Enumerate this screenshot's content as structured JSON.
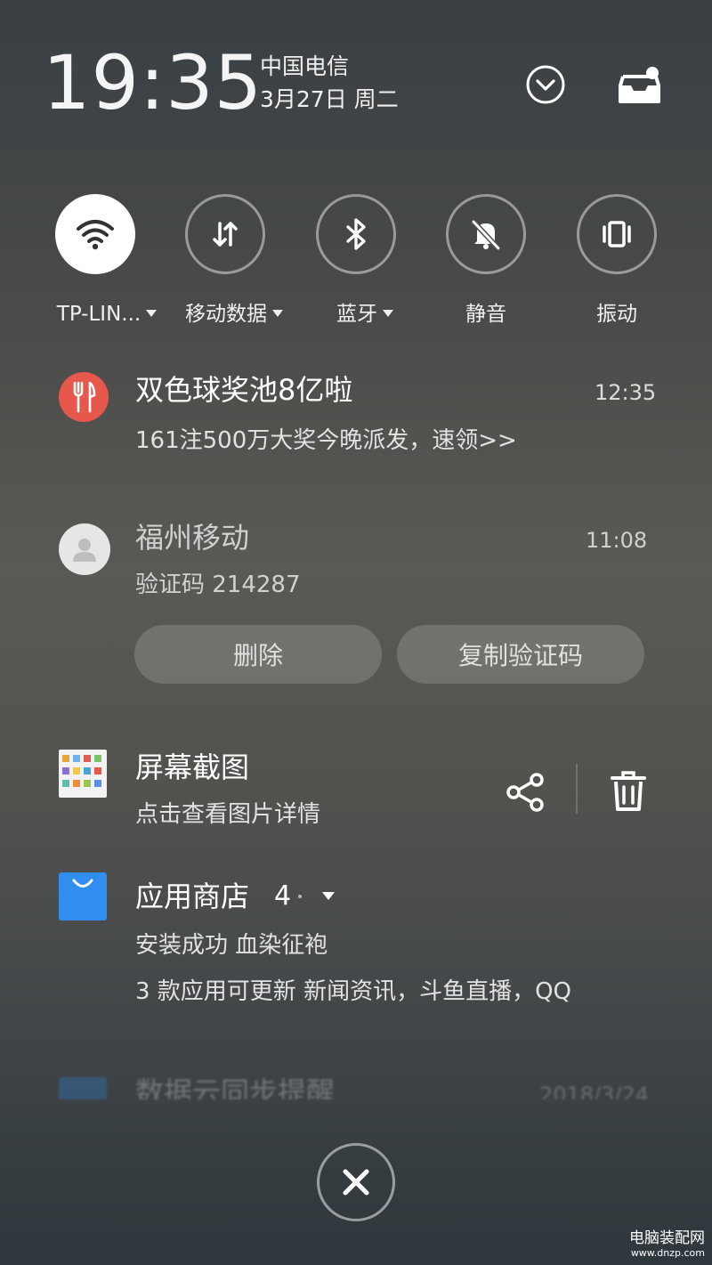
{
  "status": {
    "time": "19:35",
    "carrier": "中国电信",
    "date": "3月27日 周二"
  },
  "header_icons": [
    "chevron-down-icon",
    "inbox-icon"
  ],
  "toggles": [
    {
      "label": "TP-LIN...",
      "icon": "wifi-icon",
      "active": true,
      "has_dropdown": true
    },
    {
      "label": "移动数据",
      "icon": "mobile-data-icon",
      "active": false,
      "has_dropdown": true
    },
    {
      "label": "蓝牙",
      "icon": "bluetooth-icon",
      "active": false,
      "has_dropdown": true
    },
    {
      "label": "静音",
      "icon": "mute-icon",
      "active": false,
      "has_dropdown": false
    },
    {
      "label": "振动",
      "icon": "vibrate-icon",
      "active": false,
      "has_dropdown": false
    }
  ],
  "notifications": {
    "lottery": {
      "title": "双色球奖池8亿啦",
      "time": "12:35",
      "text": "161注500万大奖今晚派发，速领>>",
      "icon": "fork-knife-icon",
      "icon_color": "#e8574b"
    },
    "sms": {
      "title": "福州移动",
      "time": "11:08",
      "text": "验证码 214287",
      "icon": "contact-avatar-icon",
      "actions": {
        "delete": "删除",
        "copy_code": "复制验证码"
      }
    },
    "screenshot": {
      "title": "屏幕截图",
      "text": "点击查看图片详情",
      "icon": "screenshot-thumbnail",
      "actions": [
        "share-icon",
        "trash-icon"
      ]
    },
    "appstore": {
      "title": "应用商店",
      "count": "4",
      "line1": "安装成功 血染征袍",
      "line2": "3 款应用可更新 新闻资讯，斗鱼直播，QQ",
      "icon": "shopping-bag-icon",
      "icon_color": "#2f8ef0"
    },
    "sync": {
      "title": "数据云同步提醒",
      "time": "2018/3/24"
    }
  },
  "close_icon": "close-icon",
  "watermark": {
    "line1": "电脑装配网",
    "line2": "www.dnzp.com"
  },
  "colors": {
    "lottery_red": "#e8574b",
    "appstore_blue": "#2f8ef0"
  }
}
